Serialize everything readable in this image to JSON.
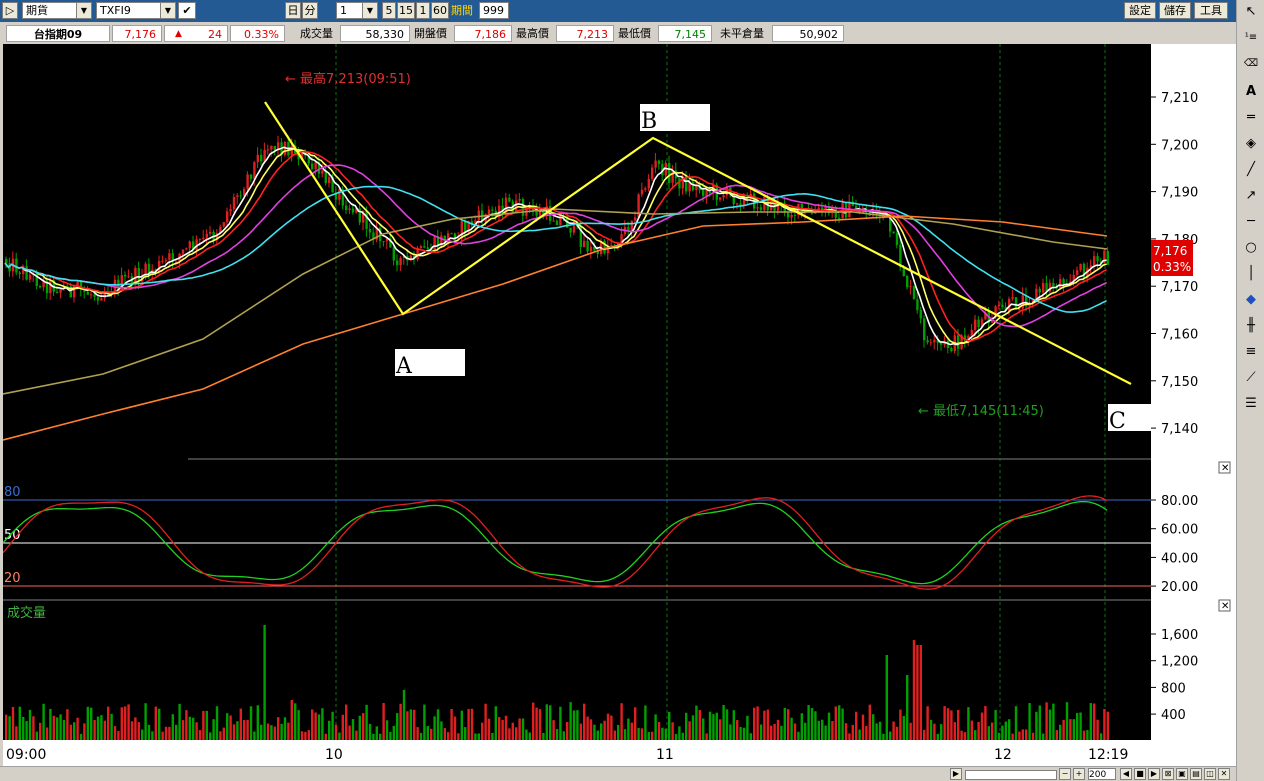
{
  "toolbar": {
    "market_select": "期貨",
    "symbol_select": "TXFI9",
    "day_button": "日",
    "minute_button": "分",
    "interval_select": "1",
    "interval_buttons": [
      "5",
      "15",
      "1",
      "60"
    ],
    "period_label": "期間",
    "period_value": "999",
    "settings_button": "設定",
    "save_button": "儲存",
    "tools_button": "工具"
  },
  "quote": {
    "name": "台指期09",
    "price": "7,176",
    "change": "24",
    "change_pct": "0.33%",
    "volume_label": "成交量",
    "volume": "58,330",
    "open_label": "開盤價",
    "open": "7,186",
    "high_label": "最高價",
    "high": "7,213",
    "low_label": "最低價",
    "low": "7,145",
    "oi_label": "未平倉量",
    "oi": "50,902"
  },
  "price_axis": {
    "ticks": [
      "7,210",
      "7,200",
      "7,190",
      "7,180",
      "7,170",
      "7,160",
      "7,150",
      "7,140"
    ],
    "last_price": "7,176",
    "last_pct": "0.33%"
  },
  "annotations": {
    "high_note": "← 最高7,213(09:51)",
    "low_note": "← 最低7,145(11:45)",
    "label_a": "A",
    "label_b": "B",
    "label_c": "C"
  },
  "kd_panel": {
    "level_80": "80",
    "level_50": "50",
    "level_20": "20",
    "ticks": [
      "80.00",
      "60.00",
      "40.00",
      "20.00"
    ]
  },
  "volume_panel": {
    "title": "成交量",
    "ticks": [
      "1,600",
      "1,200",
      "800",
      "400"
    ]
  },
  "time_axis": {
    "labels": [
      "09:00",
      "10",
      "11",
      "12",
      "12:19"
    ]
  },
  "zoom": {
    "value": "200"
  },
  "colors": {
    "toolbar_bg": "#245a93",
    "up": "#e02020",
    "down": "#00a000",
    "pattern_line": "#ffff33",
    "ma_white": "#ffffff",
    "ma_yellow": "#ffff66",
    "ma_red": "#ff2020",
    "ma_magenta": "#e040e0",
    "ma_cyan": "#40e0f0",
    "ma_olive": "#b0a050",
    "ma_orange": "#ff8030"
  }
}
